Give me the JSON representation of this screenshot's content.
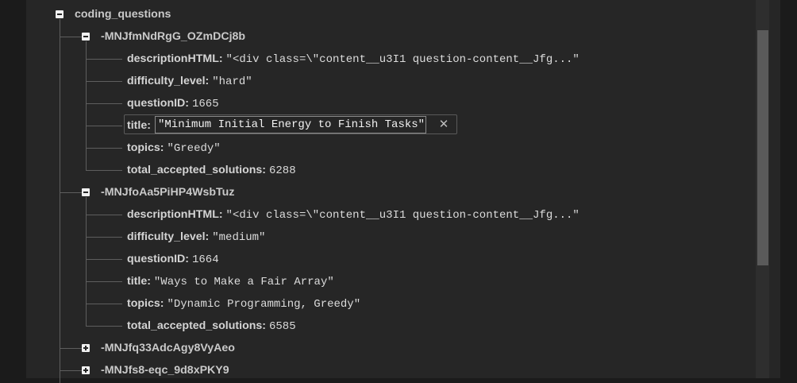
{
  "tree": {
    "root": {
      "key": "coding_questions",
      "expanded": true
    },
    "nodes": [
      {
        "key": "-MNJfmNdRgG_OZmDCj8b",
        "expanded": true,
        "fields": [
          {
            "key": "descriptionHTML:",
            "value": "\"<div class=\\\"content__u3I1 question-content__Jfg...\""
          },
          {
            "key": "difficulty_level:",
            "value": "\"hard\""
          },
          {
            "key": "questionID:",
            "value": "1665"
          },
          {
            "key": "title:",
            "value": "\"Minimum Initial Energy to Finish Tasks\"",
            "editing": true
          },
          {
            "key": "topics:",
            "value": "\"Greedy\""
          },
          {
            "key": "total_accepted_solutions:",
            "value": "6288"
          }
        ]
      },
      {
        "key": "-MNJfoAa5PiHP4WsbTuz",
        "expanded": true,
        "fields": [
          {
            "key": "descriptionHTML:",
            "value": "\"<div class=\\\"content__u3I1 question-content__Jfg...\""
          },
          {
            "key": "difficulty_level:",
            "value": "\"medium\""
          },
          {
            "key": "questionID:",
            "value": "1664"
          },
          {
            "key": "title:",
            "value": "\"Ways to Make a Fair Array\""
          },
          {
            "key": "topics:",
            "value": "\"Dynamic Programming, Greedy\""
          },
          {
            "key": "total_accepted_solutions:",
            "value": "6585"
          }
        ]
      },
      {
        "key": "-MNJfq33AdcAgy8VyAeo",
        "expanded": false,
        "fields": []
      },
      {
        "key": "-MNJfs8-eqc_9d8xPKY9",
        "expanded": false,
        "fields": []
      }
    ]
  },
  "edit": {
    "close_icon": "close-icon",
    "close_glyph": "✕"
  },
  "icons": {
    "expand": "plus-box-icon",
    "collapse": "minus-box-icon"
  },
  "colors": {
    "background": "#262626",
    "text": "#dcdcdc",
    "tree_lines": "#5e5e5e"
  }
}
